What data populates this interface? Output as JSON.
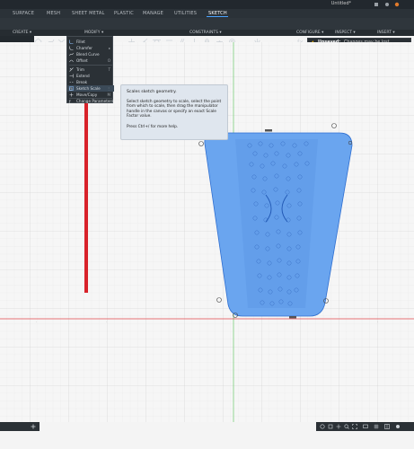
{
  "window": {
    "doc_title": "Untitled*"
  },
  "tabs": [
    {
      "label": "SURFACE",
      "active": false
    },
    {
      "label": "MESH",
      "active": false
    },
    {
      "label": "SHEET METAL",
      "active": false
    },
    {
      "label": "PLASTIC",
      "active": false
    },
    {
      "label": "MANAGE",
      "active": false
    },
    {
      "label": "UTILITIES",
      "active": false
    },
    {
      "label": "SKETCH",
      "active": true
    }
  ],
  "ribbon_groups": {
    "create": "CREATE ▾",
    "modify": "MODIFY ▾",
    "constraints": "CONSTRAINTS ▾",
    "configure": "CONFIGURE ▾",
    "inspect": "INSPECT ▾",
    "insert": "INSERT ▾"
  },
  "browser": {
    "item_text": "masa"
  },
  "banner": {
    "title": "Unsaved:",
    "message": "Changes may be lost"
  },
  "modify_menu": {
    "items": [
      {
        "label": "Fillet",
        "shortcut": "",
        "icon": "fillet-icon"
      },
      {
        "label": "Chamfer",
        "shortcut": "▸",
        "icon": "chamfer-icon"
      },
      {
        "label": "Blend Curve",
        "shortcut": "",
        "icon": "blend-curve-icon"
      },
      {
        "label": "Offset",
        "shortcut": "O",
        "icon": "offset-icon"
      },
      {
        "label": "Trim",
        "shortcut": "T",
        "icon": "trim-icon"
      },
      {
        "label": "Extend",
        "shortcut": "",
        "icon": "extend-icon"
      },
      {
        "label": "Break",
        "shortcut": "",
        "icon": "break-icon"
      },
      {
        "label": "Sketch Scale",
        "shortcut": "⋮",
        "icon": "sketch-scale-icon",
        "highlighted": true
      },
      {
        "label": "Move/Copy",
        "shortcut": "M",
        "icon": "move-copy-icon"
      },
      {
        "label": "Change Parameters",
        "shortcut": "",
        "icon": "change-parameters-icon"
      }
    ]
  },
  "tooltip": {
    "title": "Scales sketch geometry.",
    "body": "Select sketch geometry to scale, select the point from which to scale, then drag the manipulator handle in the canvas or specify an exact Scale Factor value.",
    "help": "Press Ctrl+/ for more help."
  },
  "colors": {
    "shape_fill": "#6aa5ef",
    "shape_stroke": "#2f6fd1",
    "red_axis": "#e0474d",
    "green_axis": "#7ccf7c",
    "annotation_arrow": "#d8222a",
    "accent": "#4aa3ff"
  }
}
